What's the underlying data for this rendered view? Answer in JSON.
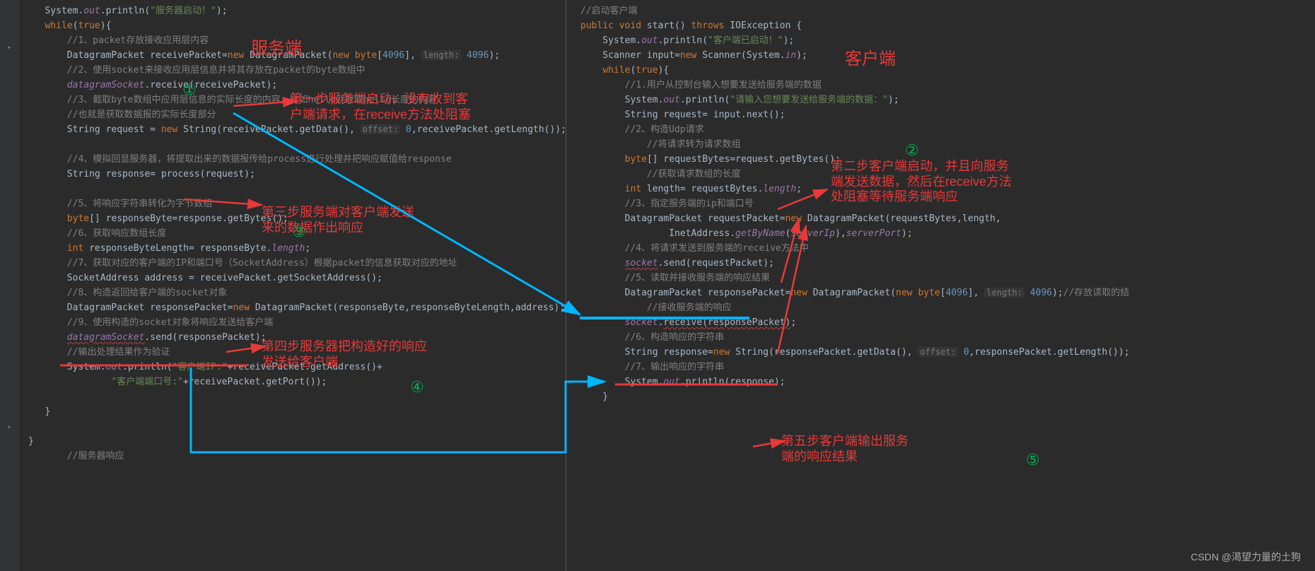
{
  "server": {
    "title": "服务端",
    "l1": "System.out.println(\"服务器启动！\");",
    "l2": "while(true){",
    "c1": "//1、packet存放接收应用层内容",
    "l3": "DatagramPacket receivePacket=new DatagramPacket(new byte[4096], length: 4096);",
    "c2": "//2、使用socket来接收应用层信息并将其存放在packet的byte数组中",
    "l4": "datagramSocket.receive(receivePacket);",
    "c3": "//3、截取byte数组中应用层信息的实际长度的内容，比如hello就截取hello长度的内容",
    "c3b": "//也就是获取数据报的实际长度部分",
    "l5": "String request = new String(receivePacket.getData(), offset: 0,receivePacket.getLength());",
    "c4": "//4、模拟回显服务器，将提取出来的数据报传给process进行处理并把响应赋值给response",
    "l6": "String response= process(request);",
    "c5": "//5、将响应字符串转化为字节数组",
    "l7": "byte[] responseByte=response.getBytes();",
    "c6": "//6、获取响应数组长度",
    "l8": "int responseByteLength= responseByte.length;",
    "c7": "//7、获取对应的客户端的IP和端口号（SocketAddress）根据packet的信息获取对应的地址",
    "l9": "SocketAddress address = receivePacket.getSocketAddress();",
    "c8": "//8、构造返回给客户端的socket对象",
    "l10": "DatagramPacket responsePacket=new DatagramPacket(responseByte,responseByteLength,address);",
    "c9": "//9、使用构造的socket对象将响应发送给客户端",
    "l11": "datagramSocket.send(responsePacket);",
    "c10": "//输出处理结果作为验证",
    "l12a": "System.out.println(\"客户端IP:\"+receivePacket.getAddress()+",
    "l12b": "\"客户端端口号:\"+receivePacket.getPort());",
    "close1": "}",
    "close2": "}",
    "c11": "//服务器响应"
  },
  "client": {
    "title": "客户端",
    "c0": "//启动客户端",
    "l1": "public void start() throws IOException {",
    "l2": "System.out.println(\"客户端已启动！\");",
    "l3": "Scanner input=new Scanner(System.in);",
    "l4": "while(true){",
    "c1": "//1.用户从控制台输入想要发送给服务端的数据",
    "l5": "System.out.println(\"请输入您想要发送给服务端的数据：\");",
    "l6": "String request= input.next();",
    "c2": "//2、构造Udp请求",
    "c2b": "//将请求转为请求数组",
    "l7": "byte[] requestBytes=request.getBytes();",
    "c2c": "//获取请求数组的长度",
    "l8": "int length= requestBytes.length;",
    "c3": "//3、指定服务端的ip和端口号",
    "l9a": "DatagramPacket requestPacket=new DatagramPacket(requestBytes,length,",
    "l9b": "InetAddress.getByName(serverIp),serverPort);",
    "c4": "//4、将请求发送到服务端的receive方法中",
    "l10": "socket.send(requestPacket);",
    "c5": "//5、读取并接收服务端的响应结果",
    "l11": "DatagramPacket responsePacket=new DatagramPacket(new byte[4096], length: 4096);//存放读取的结",
    "c5b": "//接收服务端的响应",
    "l12": "socket.receive(responsePacket);",
    "c6": "//6、构造响应的字符串",
    "l13": "String response=new String(responsePacket.getData(), offset: 0,responsePacket.getLength());",
    "c7": "//7、输出响应的字符串",
    "l14": "System.out.println(response);",
    "close1": "}"
  },
  "annotations": {
    "a1": "第一步服务端启动，没有收到客\n户端请求，在receive方法处阻塞",
    "a2": "第二步客户端启动，并且向服务\n端发送数据，然后在receive方法\n处阻塞等待服务端响应",
    "a3": "第三步服务端对客户端发送\n来的数据作出响应",
    "a4": "第四步服务器把构造好的响应\n发送给客户端",
    "a5": "第五步客户端输出服务\n端的响应结果"
  },
  "watermark": "CSDN @渴望力量的土狗"
}
